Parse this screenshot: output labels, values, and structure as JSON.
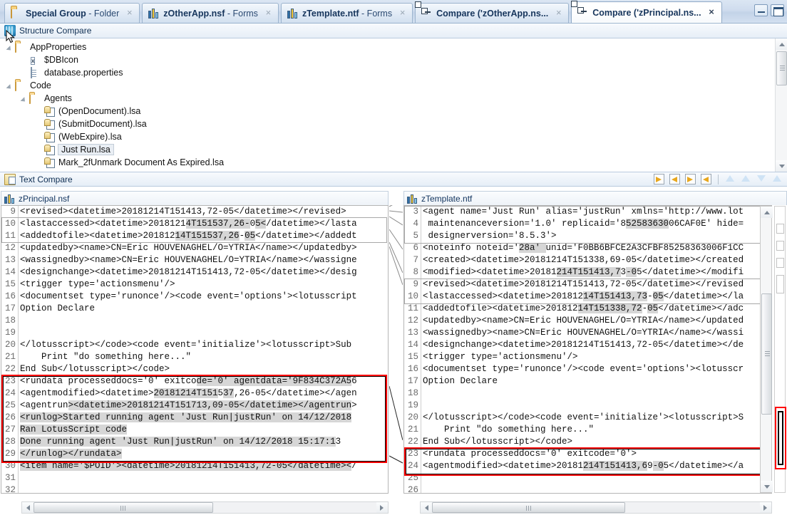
{
  "window": {
    "minimize_label": "Minimize",
    "restore_label": "Restore"
  },
  "tabs": [
    {
      "name": "Special Group",
      "suffix": " - Folder",
      "icon": "folder-icon",
      "active": false,
      "close": "×"
    },
    {
      "name": "zOtherApp.nsf",
      "suffix": " - Forms",
      "icon": "nsf-database-icon",
      "active": false,
      "close": "×"
    },
    {
      "name": "zTemplate.ntf",
      "suffix": " - Forms",
      "icon": "nsf-database-icon",
      "active": false,
      "close": "×"
    },
    {
      "name": "Compare ('zOtherApp.ns...",
      "suffix": "",
      "icon": "compare-icon",
      "active": false,
      "close": "×"
    },
    {
      "name": "Compare ('zPrincipal.ns...",
      "suffix": "",
      "icon": "compare-icon",
      "active": true,
      "close": "×"
    }
  ],
  "structure_compare": {
    "title": "Structure Compare",
    "icon": "structure-compare-icon",
    "tree": [
      {
        "label": "AppProperties",
        "indent": 1,
        "icon": "folder-icon",
        "arrow": "expanded",
        "selected": false
      },
      {
        "label": "$DBIcon",
        "indent": 2,
        "icon": "x-file-icon",
        "arrow": "none",
        "selected": false
      },
      {
        "label": "database.properties",
        "indent": 2,
        "icon": "document-icon",
        "arrow": "none",
        "selected": false
      },
      {
        "label": "Code",
        "indent": 1,
        "icon": "folder-icon",
        "arrow": "expanded",
        "selected": false
      },
      {
        "label": "Agents",
        "indent": 2,
        "icon": "folder-icon",
        "arrow": "expanded",
        "selected": false
      },
      {
        "label": "(OpenDocument).lsa",
        "indent": 3,
        "icon": "lsa-file-icon",
        "arrow": "none",
        "selected": false
      },
      {
        "label": "(SubmitDocument).lsa",
        "indent": 3,
        "icon": "lsa-file-icon",
        "arrow": "none",
        "selected": false
      },
      {
        "label": "(WebExpire).lsa",
        "indent": 3,
        "icon": "lsa-file-icon",
        "arrow": "none",
        "selected": false
      },
      {
        "label": "Just Run.lsa",
        "indent": 3,
        "icon": "lsa-file-icon",
        "arrow": "none",
        "selected": true
      },
      {
        "label": "Mark_2fUnmark Document As Expired.lsa",
        "indent": 3,
        "icon": "lsa-file-icon",
        "arrow": "none",
        "selected": false
      }
    ]
  },
  "text_compare": {
    "title": "Text Compare",
    "icon": "text-compare-icon",
    "toolbar": [
      {
        "name": "copy-all-left-to-right",
        "glyph": "⇒"
      },
      {
        "name": "copy-all-right-to-left",
        "glyph": "⇐"
      },
      {
        "name": "copy-current-left-to-right",
        "glyph": "⇒"
      },
      {
        "name": "copy-current-right-to-left",
        "glyph": "⇐"
      },
      {
        "name": "next-difference",
        "glyph": "▼"
      },
      {
        "name": "previous-difference",
        "glyph": "▲"
      },
      {
        "name": "next-change",
        "glyph": "▼"
      },
      {
        "name": "previous-change",
        "glyph": "▲"
      }
    ],
    "left": {
      "file": "zPrincipal.nsf",
      "icon": "nsf-database-icon",
      "lines": [
        {
          "n": 9,
          "text": "<revised><datetime>20181214T151413,72-05</datetime></revised>"
        },
        {
          "n": 10,
          "text": "<lastaccessed><datetime>20181214T151537,26-05</datetime></lasta"
        },
        {
          "n": 11,
          "text": "<addedtofile><datetime>20181214T151537,26-05</datetime></addedt"
        },
        {
          "n": 12,
          "text": "<updatedby><name>CN=Eric HOUVENAGHEL/O=YTRIA</name></updatedby>"
        },
        {
          "n": 13,
          "text": "<wassignedby><name>CN=Eric HOUVENAGHEL/O=YTRIA</name></wassigne"
        },
        {
          "n": 14,
          "text": "<designchange><datetime>20181214T151413,72-05</datetime></desig"
        },
        {
          "n": 15,
          "text": "<trigger type='actionsmenu'/>"
        },
        {
          "n": 16,
          "text": "<documentset type='runonce'/><code event='options'><lotusscript"
        },
        {
          "n": 17,
          "text": "Option Declare"
        },
        {
          "n": 18,
          "text": ""
        },
        {
          "n": 19,
          "text": ""
        },
        {
          "n": 20,
          "text": "</lotusscript></code><code event='initialize'><lotusscript>Sub"
        },
        {
          "n": 21,
          "text": "    Print \"do something here...\""
        },
        {
          "n": 22,
          "text": "End Sub</lotusscript></code>"
        },
        {
          "n": 23,
          "text": "<rundata processeddocs='0' exitcode='0' agentdata='9F834C372A56"
        },
        {
          "n": 24,
          "text": "<agentmodified><datetime>20181214T151537,26-05</datetime></agen"
        },
        {
          "n": 25,
          "text": "<agentrun><datetime>20181214T151713,09-05</datetime></agentrun>"
        },
        {
          "n": 26,
          "text": "<runlog>Started running agent 'Just Run|justRun' on 14/12/2018"
        },
        {
          "n": 27,
          "text": "Ran LotusScript code"
        },
        {
          "n": 28,
          "text": "Done running agent 'Just Run|justRun' on 14/12/2018 15:17:13"
        },
        {
          "n": 29,
          "text": "</runlog></rundata>"
        },
        {
          "n": 30,
          "text": "<item name='$POID'><datetime>20181214T151413,72-05</datetime></"
        },
        {
          "n": 31,
          "text": ""
        },
        {
          "n": 32,
          "text": ""
        }
      ]
    },
    "right": {
      "file": "zTemplate.ntf",
      "icon": "nsf-database-icon",
      "lines": [
        {
          "n": 3,
          "text": "<agent name='Just Run' alias='justRun' xmlns='http://www.lot"
        },
        {
          "n": 4,
          "text": " maintenanceversion='1.0' replicaid='85258363006CAF0E' hide="
        },
        {
          "n": 5,
          "text": " designerversion='8.5.3'>"
        },
        {
          "n": 6,
          "text": "<noteinfo noteid='28a' unid='F0BB6BFCE2A3CFBF85258363006F1CC"
        },
        {
          "n": 7,
          "text": "<created><datetime>20181214T151338,69-05</datetime></created"
        },
        {
          "n": 8,
          "text": "<modified><datetime>20181214T151413,73-05</datetime></modifi"
        },
        {
          "n": 9,
          "text": "<revised><datetime>20181214T151413,72-05</datetime></revised"
        },
        {
          "n": 10,
          "text": "<lastaccessed><datetime>20181214T151413,73-05</datetime></la"
        },
        {
          "n": 11,
          "text": "<addedtofile><datetime>20181214T151338,72-05</datetime></adc"
        },
        {
          "n": 12,
          "text": "<updatedby><name>CN=Eric HOUVENAGHEL/O=YTRIA</name></updated"
        },
        {
          "n": 13,
          "text": "<wassignedby><name>CN=Eric HOUVENAGHEL/O=YTRIA</name></wassi"
        },
        {
          "n": 14,
          "text": "<designchange><datetime>20181214T151413,72-05</datetime></de"
        },
        {
          "n": 15,
          "text": "<trigger type='actionsmenu'/>"
        },
        {
          "n": 16,
          "text": "<documentset type='runonce'/><code event='options'><lotusscr"
        },
        {
          "n": 17,
          "text": "Option Declare"
        },
        {
          "n": 18,
          "text": ""
        },
        {
          "n": 19,
          "text": ""
        },
        {
          "n": 20,
          "text": "</lotusscript></code><code event='initialize'><lotusscript>S"
        },
        {
          "n": 21,
          "text": "    Print \"do something here...\""
        },
        {
          "n": 22,
          "text": "End Sub</lotusscript></code>"
        },
        {
          "n": 23,
          "text": "<rundata processeddocs='0' exitcode='0'>"
        },
        {
          "n": 24,
          "text": "<agentmodified><datetime>20181214T151413,69-05</datetime></a"
        },
        {
          "n": 25,
          "text": ""
        },
        {
          "n": 26,
          "text": ""
        }
      ]
    }
  },
  "colors": {
    "diff_highlight": "#d6d6d6",
    "selection_border": "#ff0000",
    "tab_active_bg": "#ffffff",
    "tabbar_bg": "#cfdcee",
    "panel_header_bg": "#e6eef7"
  }
}
